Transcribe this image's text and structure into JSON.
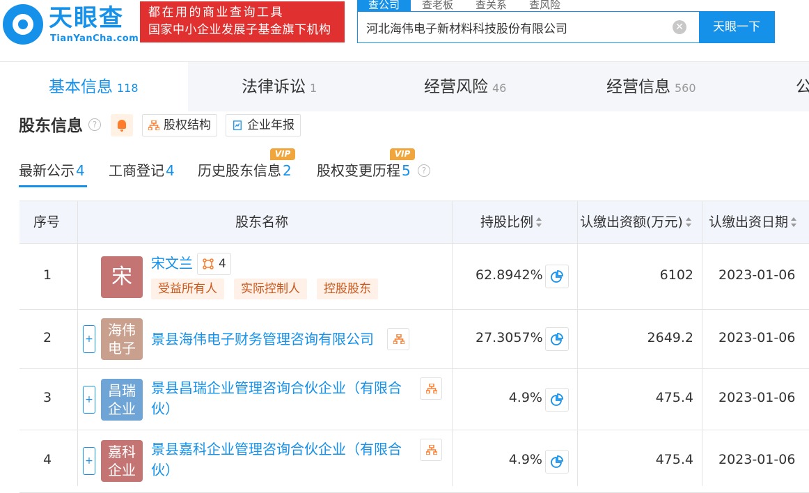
{
  "header": {
    "logo_cn": "天眼查",
    "logo_en": "TianYanCha.com",
    "slogan_line1": "都在用的商业查询工具",
    "slogan_line2": "国家中小企业发展子基金旗下机构",
    "search_tabs": [
      "查公司",
      "查老板",
      "查关系",
      "查风险"
    ],
    "search_value": "河北海伟电子新材料科技股份有限公司",
    "search_button": "天眼一下"
  },
  "main_tabs": [
    {
      "label": "基本信息",
      "count": "118"
    },
    {
      "label": "法律诉讼",
      "count": "1"
    },
    {
      "label": "经营风险",
      "count": "46"
    },
    {
      "label": "经营信息",
      "count": "560"
    },
    {
      "label": "公",
      "count": ""
    }
  ],
  "section": {
    "title": "股东信息",
    "help": "?",
    "equity_structure_btn": "股权结构",
    "annual_report_btn": "企业年报"
  },
  "sub_tabs": [
    {
      "label": "最新公示",
      "count": "4"
    },
    {
      "label": "工商登记",
      "count": "4"
    },
    {
      "label": "历史股东信息",
      "count": "2"
    },
    {
      "label": "股权变更历程",
      "count": "5"
    }
  ],
  "vip_label": "VIP",
  "table": {
    "headers": [
      "序号",
      "股东名称",
      "持股比例",
      "认缴出资额(万元)",
      "认缴出资日期"
    ],
    "rows": [
      {
        "no": "1",
        "avatar": "宋",
        "avatar_color": "#c57474",
        "name": "宋文兰",
        "count": "4",
        "tags": [
          "受益所有人",
          "实际控制人",
          "控股股东"
        ],
        "ratio": "62.8942%",
        "amount": "6102",
        "date": "2023-01-06"
      },
      {
        "no": "2",
        "avatar_l1": "海伟",
        "avatar_l2": "电子",
        "avatar_color": "#c9a08e",
        "name": "景县海伟电子财务管理咨询有限公司",
        "ratio": "27.3057%",
        "amount": "2649.2",
        "date": "2023-01-06"
      },
      {
        "no": "3",
        "avatar_l1": "昌瑞",
        "avatar_l2": "企业",
        "avatar_color": "#6fa5d6",
        "name_l1": "景县昌瑞企业管理咨询合伙企业（有限合",
        "name_l2": "伙）",
        "ratio": "4.9%",
        "amount": "475.4",
        "date": "2023-01-06"
      },
      {
        "no": "4",
        "avatar_l1": "嘉科",
        "avatar_l2": "企业",
        "avatar_color": "#c57474",
        "name_l1": "景县嘉科企业管理咨询合伙企业（有限合",
        "name_l2": "伙）",
        "ratio": "4.9%",
        "amount": "475.4",
        "date": "2023-01-06"
      }
    ]
  },
  "colors": {
    "brand": "#1591ea",
    "slogan_bg": "#e03030",
    "tag": "#c9581d",
    "vip": "#f0a63c"
  }
}
